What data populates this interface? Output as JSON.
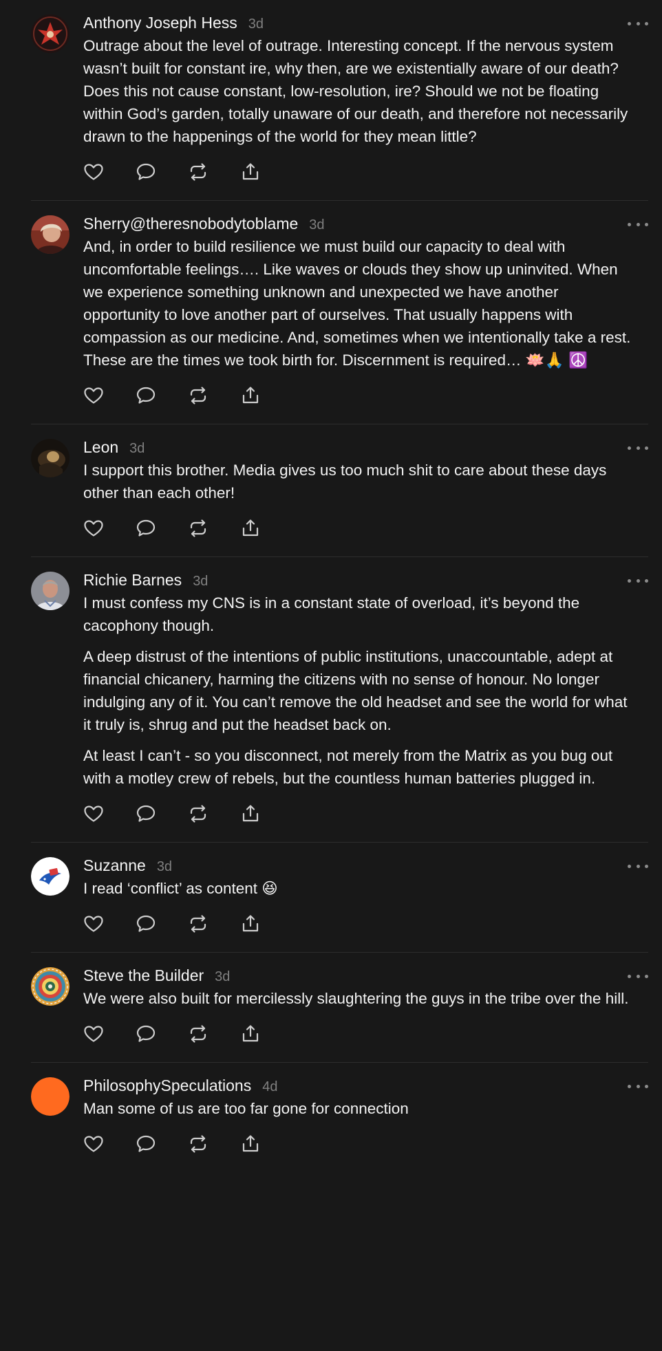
{
  "colors": {
    "background": "#181818",
    "text": "#f3f3f3",
    "muted": "#808080",
    "divider": "#2d2d2d"
  },
  "icons": {
    "like": "heart-icon",
    "reply": "comment-icon",
    "repost": "repost-icon",
    "share": "share-icon",
    "more": "more-icon"
  },
  "posts": [
    {
      "author": "Anthony Joseph Hess",
      "time": "3d",
      "avatar": "red-emblem",
      "paragraphs": [
        "Outrage about the level of outrage. Interesting concept. If the nervous system wasn’t built for constant ire, why then, are we existentially aware of our death? Does this not cause constant, low-resolution, ire? Should we not be floating within God’s garden, totally unaware of our death, and therefore not necessarily drawn to the happenings of the world for they mean little?"
      ]
    },
    {
      "author": "Sherry@theresnobodytoblame",
      "time": "3d",
      "avatar": "portrait-warm",
      "paragraphs": [
        "And, in order to build resilience we must build our capacity to deal with uncomfortable feelings…. Like waves or clouds they show up uninvited. When we experience something unknown and unexpected we have another opportunity to love another part of ourselves. That usually happens with compassion as our medicine. And, sometimes when we intentionally take a rest. These are the times we took birth for. Discernment is required… 🪷🙏 ☮️"
      ]
    },
    {
      "author": "Leon",
      "time": "3d",
      "avatar": "dark-painting",
      "paragraphs": [
        "I support this brother. Media gives us too much shit to care about these days other than each other!"
      ]
    },
    {
      "author": "Richie Barnes",
      "time": "3d",
      "avatar": "portrait-man",
      "paragraphs": [
        "I must confess my CNS is in a constant state of overload, it’s beyond the cacophony though.",
        "A deep distrust of the intentions of public institutions, unaccountable, adept at financial chicanery, harming the citizens with no sense of honour. No longer indulging any of it. You can’t remove the old headset and see the world for what it truly is, shrug and put the headset back on.",
        "At least I can’t - so you disconnect, not merely from the Matrix as you bug out with a motley crew of rebels, but the countless human batteries plugged in."
      ]
    },
    {
      "author": "Suzanne",
      "time": "3d",
      "avatar": "bird-logo",
      "paragraphs": [
        "I read ‘conflict’ as content 😆"
      ]
    },
    {
      "author": "Steve the Builder",
      "time": "3d",
      "avatar": "mandala",
      "paragraphs": [
        "We were also built for mercilessly slaughtering the guys in the tribe over the hill."
      ]
    },
    {
      "author": "PhilosophySpeculations",
      "time": "4d",
      "avatar": "orange-circle",
      "paragraphs": [
        "Man some of us are too far gone for connection"
      ]
    }
  ]
}
